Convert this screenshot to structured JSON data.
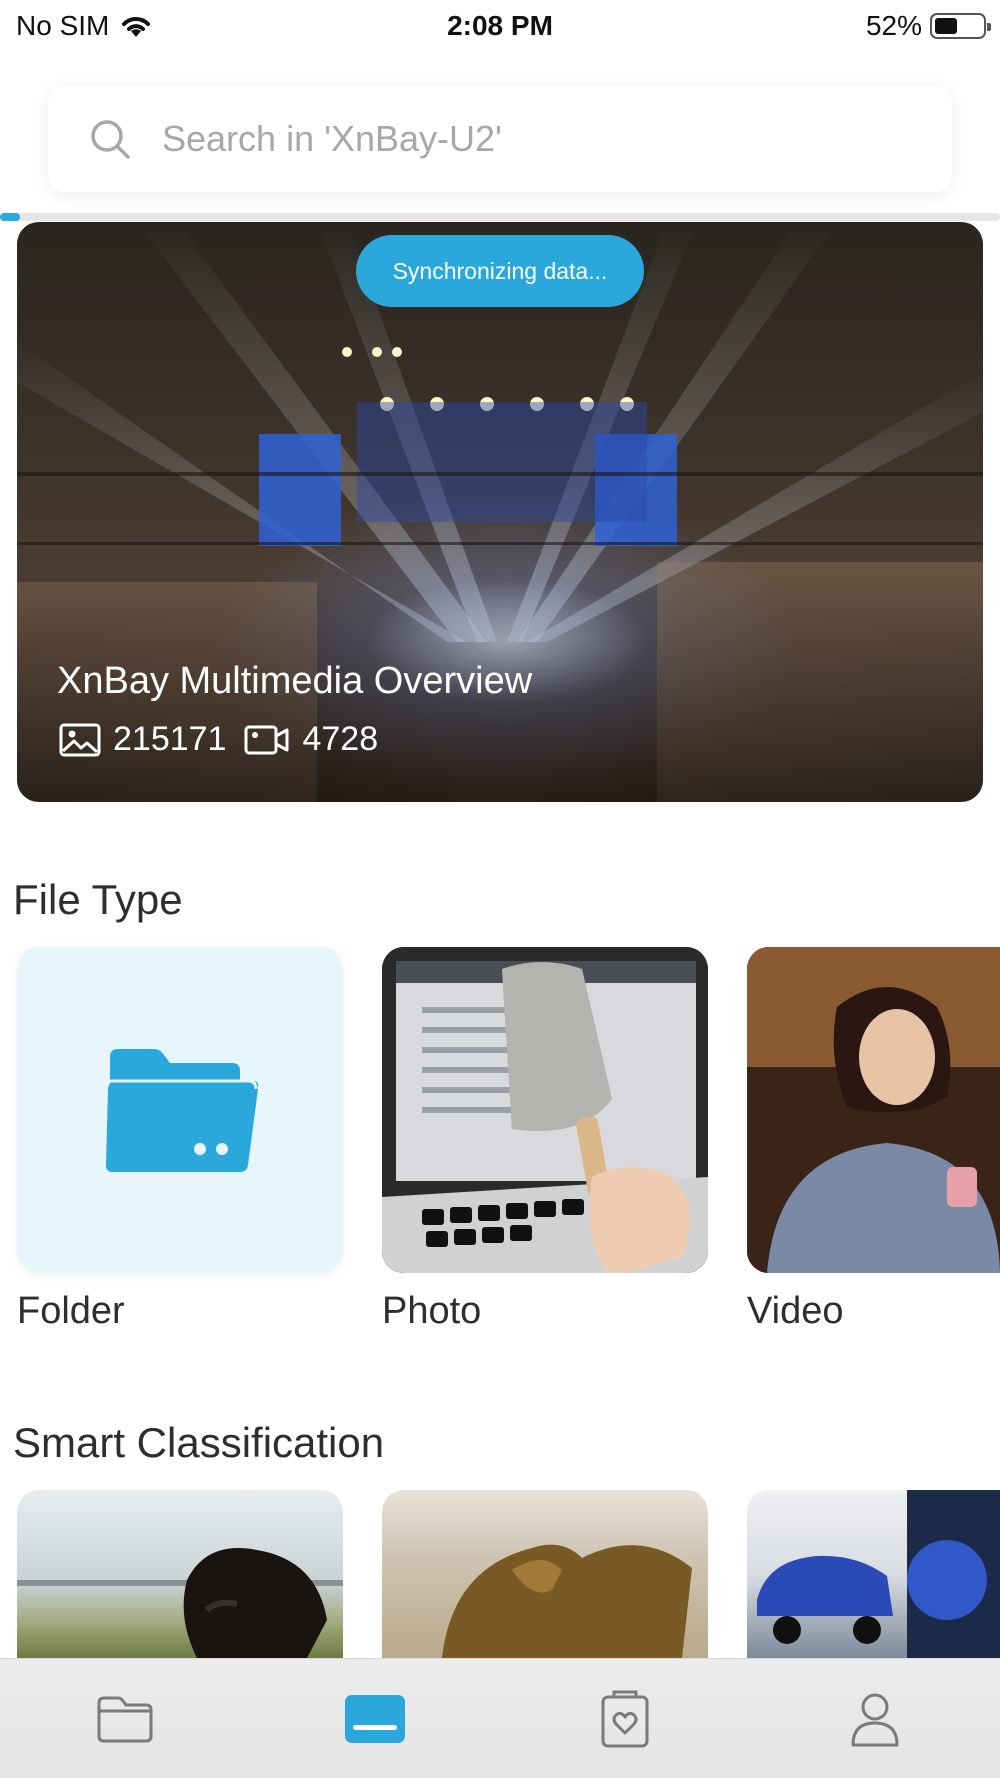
{
  "status_bar": {
    "carrier": "No SIM",
    "time": "2:08 PM",
    "battery": "52%"
  },
  "search": {
    "placeholder": "Search in 'XnBay-U2'"
  },
  "sync": {
    "progress_fraction": 0.02,
    "label": "Synchronizing data..."
  },
  "hero": {
    "title": "XnBay Multimedia Overview",
    "photo_count": "215171",
    "video_count": "4728"
  },
  "file_type": {
    "title": "File Type",
    "items": [
      {
        "label": "Folder",
        "icon": "folder-icon"
      },
      {
        "label": "Photo"
      },
      {
        "label": "Video"
      }
    ]
  },
  "smart_classification": {
    "title": "Smart Classification"
  },
  "tab_bar": {
    "items": [
      {
        "icon": "folder-icon",
        "active": false
      },
      {
        "icon": "drive-icon",
        "active": true
      },
      {
        "icon": "favorites-icon",
        "active": false
      },
      {
        "icon": "person-icon",
        "active": false
      }
    ],
    "active_color": "#2aa7db",
    "inactive_color": "#7a7a7a"
  },
  "colors": {
    "accent": "#2aa7db",
    "folder_bg": "#e6f6fc"
  }
}
